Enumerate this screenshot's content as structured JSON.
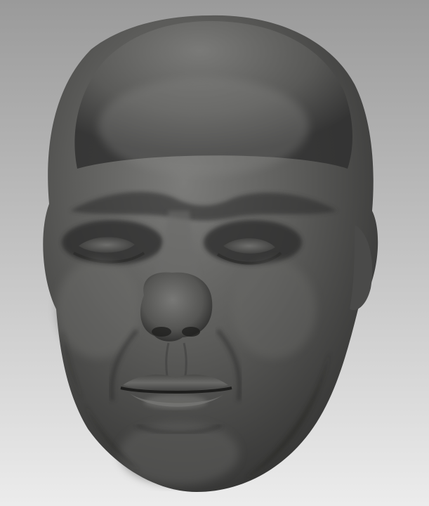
{
  "viewport": {
    "subject": "head-sculpt",
    "colors": {
      "background_top": "#9a9a9a",
      "background_bottom": "#ececec",
      "clay_light": "#7a7a78",
      "clay_mid": "#585856",
      "clay_dark": "#2e2e2d",
      "clay_shadow": "#1f1f1e"
    }
  }
}
